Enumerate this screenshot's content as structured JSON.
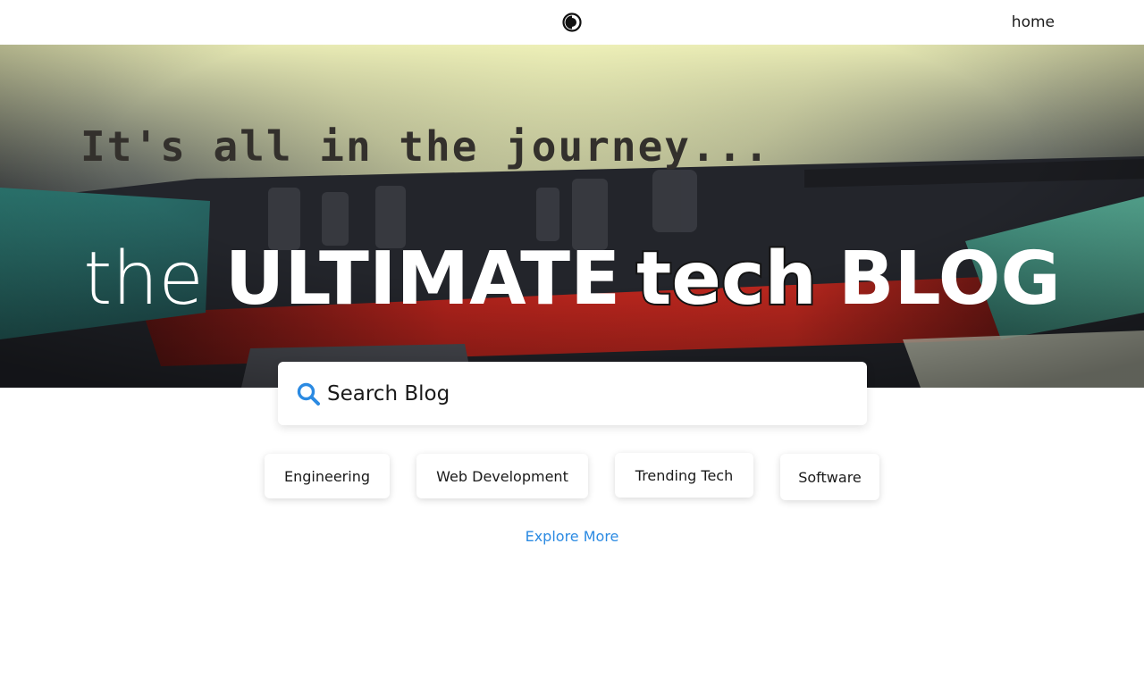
{
  "nav": {
    "home_label": "home",
    "theme_toggle_icon": "contrast-icon"
  },
  "hero": {
    "background_text": "It's all in the journey...",
    "title_words": [
      "the",
      "ULTIMATE",
      "tech",
      "BLOG"
    ]
  },
  "search": {
    "placeholder": "Search Blog",
    "value": "",
    "icon": "search-icon",
    "icon_color": "#2b8ae2"
  },
  "categories": [
    "Engineering",
    "Web Development",
    "Trending Tech",
    "Software"
  ],
  "explore_label": "Explore More",
  "colors": {
    "accent": "#2b8ae2",
    "hero_red": "#a8201a",
    "hero_teal": "#3f9a8a"
  }
}
